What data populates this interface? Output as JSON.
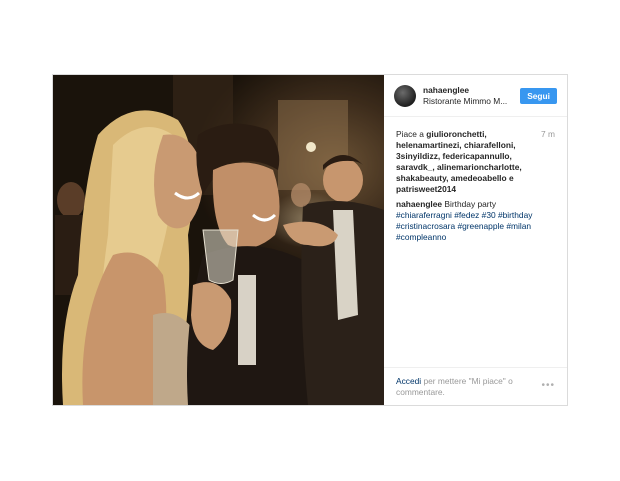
{
  "header": {
    "username": "nahaenglee",
    "location": "Ristorante Mimmo M...",
    "follow_label": "Segui"
  },
  "likes": {
    "prefix": "Piace a ",
    "names": "giulioronchetti, helenamartinezi, chiarafelloni, 3sinyildizz, federicapannullo, saravdk_, alinemarioncharlotte, shakabeauty, amedeoabello e patrisweet2014",
    "time": "7 m"
  },
  "caption": {
    "username": "nahaenglee",
    "text": " Birthday party",
    "hashtags": "#chiaraferragni #fedez #30 #birthday #cristinacrosara #greenapple #milan #compleanno"
  },
  "footer": {
    "login": "Accedi",
    "rest": " per mettere \"Mi piace\" o commentare.",
    "more_icon": "•••"
  },
  "colors": {
    "follow": "#3897f0",
    "link": "#003569",
    "muted": "#999999"
  }
}
